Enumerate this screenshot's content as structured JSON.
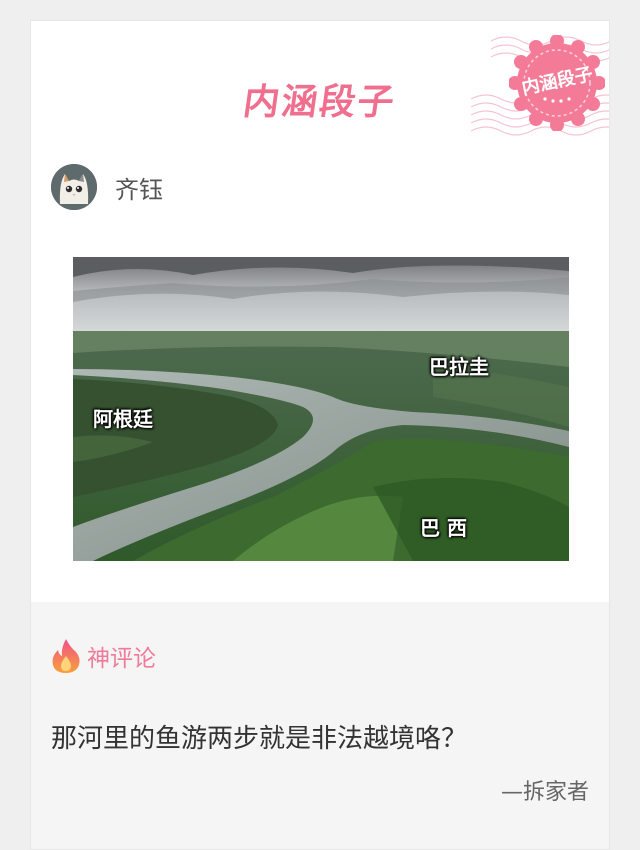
{
  "banner": {
    "title": "内涵段子",
    "stamp_text": "内涵段子"
  },
  "post": {
    "author_name": "齐钰",
    "image_labels": {
      "paraguay": "巴拉圭",
      "argentina": "阿根廷",
      "brazil": "巴 西"
    }
  },
  "comment": {
    "section_label": "神评论",
    "text": "那河里的鱼游两步就是非法越境咯？",
    "author": "—拆家者"
  },
  "colors": {
    "brand_pink": "#f06f8e",
    "background": "#efefef"
  },
  "icons": {
    "fire": "fire-icon",
    "stamp": "stamp-icon"
  }
}
